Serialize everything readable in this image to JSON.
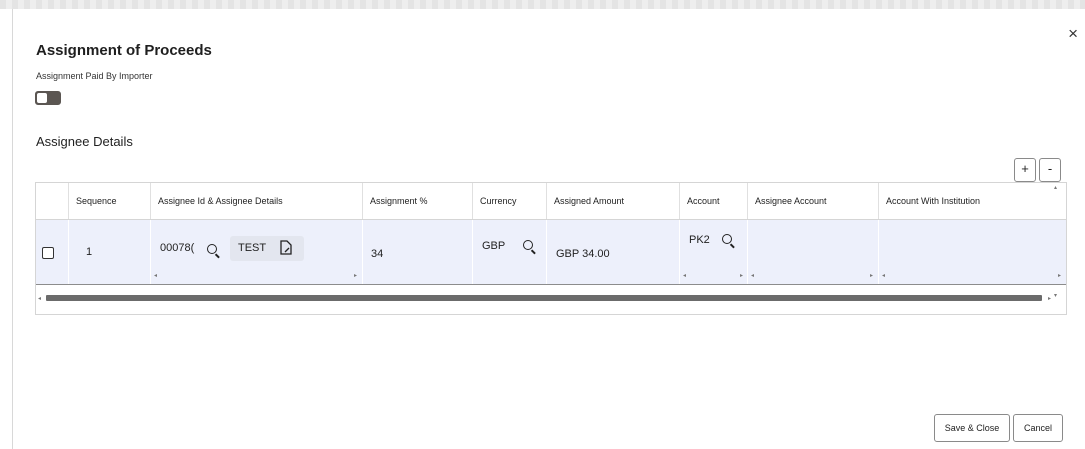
{
  "dialog": {
    "title": "Assignment of Proceeds",
    "toggle_label": "Assignment Paid By Importer",
    "toggle_on": false,
    "section_title": "Assignee Details",
    "add_label": "+",
    "remove_label": "-",
    "close_label": "×"
  },
  "table": {
    "columns": [
      "Sequence",
      "Assignee Id & Assignee Details",
      "Assignment %",
      "Currency",
      "Assigned Amount",
      "Account",
      "Assignee Account",
      "Account With Institution"
    ],
    "rows": [
      {
        "sequence": "1",
        "assignee_id": "00078(",
        "assignee_name": "TEST",
        "assignment_pct": "34",
        "currency": "GBP",
        "assigned_amount": "GBP 34.00",
        "account": "PK2",
        "assignee_account": "",
        "account_with_institution": ""
      }
    ]
  },
  "footer": {
    "save_close": "Save & Close",
    "cancel": "Cancel"
  }
}
